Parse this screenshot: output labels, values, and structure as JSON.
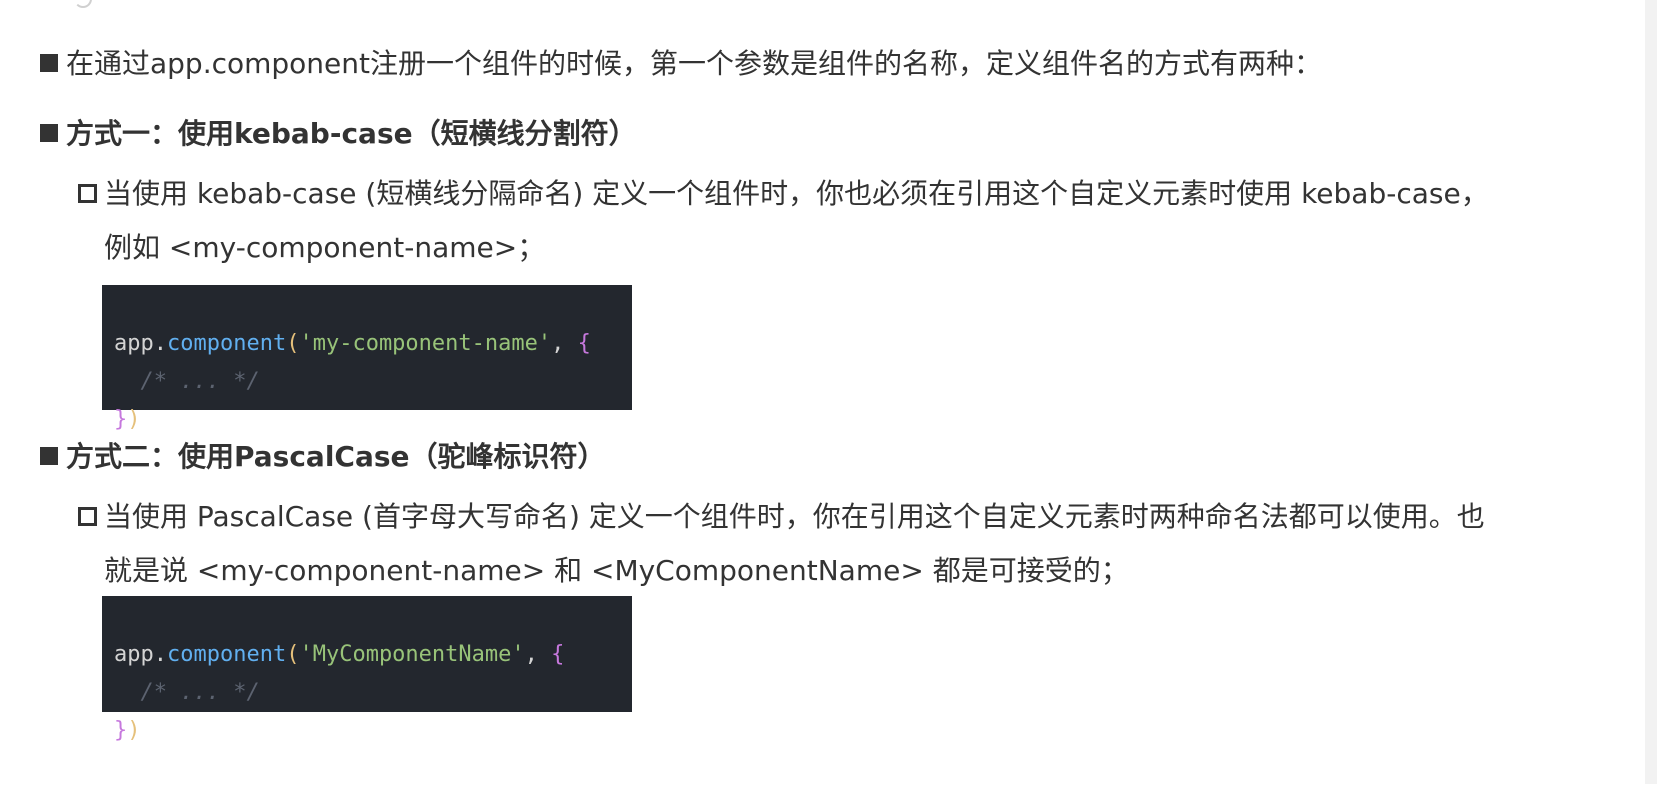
{
  "paragraph_intro": {
    "text": "在通过app.component注册一个组件的时候，第一个参数是组件的名称，定义组件名的方式有两种："
  },
  "method_one": {
    "heading": "方式一：使用kebab-case（短横线分割符）",
    "desc_line1": "当使用 kebab-case (短横线分隔命名) 定义一个组件时，你也必须在引用这个自定义元素时使用 kebab-case，",
    "desc_line2": "例如 <my-component-name>；",
    "code": {
      "obj": "app",
      "dot": ".",
      "method": "component",
      "open_paren": "(",
      "string": "'my-component-name'",
      "comma": ", ",
      "open_brace": "{",
      "indent": "  ",
      "comment": "/* ... */",
      "close_brace": "}",
      "close_paren": ")"
    }
  },
  "method_two": {
    "heading": "方式二：使用PascalCase（驼峰标识符）",
    "desc_line1": "当使用 PascalCase (首字母大写命名) 定义一个组件时，你在引用这个自定义元素时两种命名法都可以使用。也",
    "desc_line2": "就是说 <my-component-name> 和 <MyComponentName> 都是可接受的；",
    "code": {
      "obj": "app",
      "dot": ".",
      "method": "component",
      "open_paren": "(",
      "string": "'MyComponentName'",
      "comma": ", ",
      "open_brace": "{",
      "indent": "  ",
      "comment": "/* ... */",
      "close_brace": "}",
      "close_paren": ")"
    }
  },
  "colors": {
    "text": "#333333",
    "code_bg": "#23272e",
    "code_method": "#61afef",
    "code_string": "#98c379",
    "code_brace": "#c678dd",
    "code_paren": "#e5c07b",
    "code_comment": "#5c6370"
  }
}
